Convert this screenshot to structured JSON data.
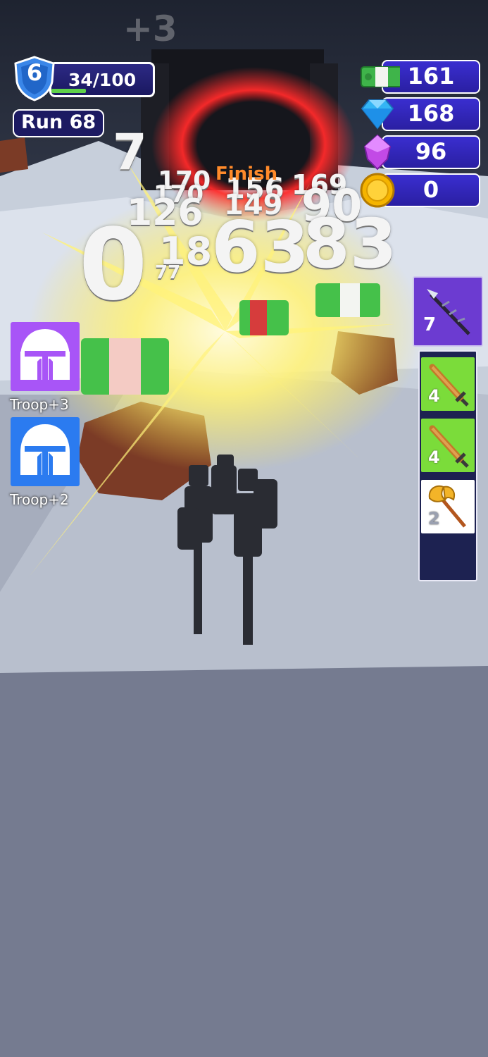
{
  "hud": {
    "level": "6",
    "xp_text": "34/100",
    "xp_progress": 0.34,
    "run_label": "Run 68",
    "plus_indicator": "+3"
  },
  "currencies": [
    {
      "name": "cash",
      "icon": "cash-icon",
      "value": "161"
    },
    {
      "name": "diamond",
      "icon": "diamond-icon",
      "value": "168"
    },
    {
      "name": "gem",
      "icon": "purple-gem-icon",
      "value": "96"
    },
    {
      "name": "coin",
      "icon": "gold-coin-icon",
      "value": "0"
    }
  ],
  "troop_cards": [
    {
      "label": "Troop+3",
      "icon": "knight-helmet-icon",
      "color": "#a855f7"
    },
    {
      "label": "Troop+2",
      "icon": "knight-helmet-icon",
      "color": "#2b7bf0"
    }
  ],
  "weapons": {
    "featured": {
      "icon": "spear-icon",
      "count": "7",
      "color": "#6c3bd1"
    },
    "slots": [
      {
        "icon": "sword-icon",
        "count": "4",
        "color": "#7bdc3a"
      },
      {
        "icon": "sword-icon",
        "count": "4",
        "color": "#7bdc3a"
      },
      {
        "icon": "battle-axe-icon",
        "count": "2",
        "color": "#ffffff"
      }
    ]
  },
  "scene": {
    "finish_label": "Finish",
    "floating_numbers": [
      "7",
      "170",
      "156",
      "169",
      "170",
      "126",
      "149",
      "90",
      "0",
      "18",
      "63",
      "83",
      "77"
    ]
  }
}
